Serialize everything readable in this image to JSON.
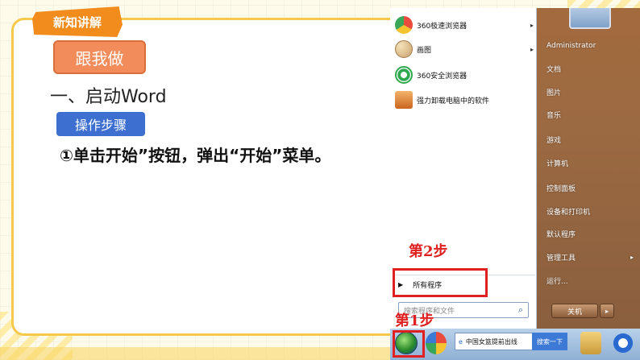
{
  "slide": {
    "section_tag": "新知讲解",
    "follow_button": "跟我做",
    "heading": "一、启动Word",
    "steps_label": "操作步骤",
    "instruction": "①单击开始”按钮，弹出“开始”菜单。"
  },
  "start_menu": {
    "programs": [
      {
        "label": "360极速浏览器",
        "icon": "chrome-like-icon",
        "has_arrow": true,
        "color": "#e94c3d"
      },
      {
        "label": "画图",
        "icon": "paint-palette-icon",
        "has_arrow": true,
        "color": "#5fa4e0"
      },
      {
        "label": "360安全浏览器",
        "icon": "ie-like-icon",
        "has_arrow": false,
        "color": "#2fa84f"
      },
      {
        "label": "强力卸载电脑中的软件",
        "icon": "uninstall-box-icon",
        "has_arrow": false,
        "color": "#e0813a"
      }
    ],
    "all_programs": "所有程序",
    "search_placeholder": "搜索程序和文件",
    "places": [
      {
        "label": "Administrator",
        "has_arrow": false
      },
      {
        "label": "文档",
        "has_arrow": false
      },
      {
        "label": "图片",
        "has_arrow": false
      },
      {
        "label": "音乐",
        "has_arrow": false
      },
      {
        "label": "游戏",
        "has_arrow": false
      },
      {
        "label": "计算机",
        "has_arrow": false
      },
      {
        "label": "控制面板",
        "has_arrow": false
      },
      {
        "label": "设备和打印机",
        "has_arrow": false
      },
      {
        "label": "默认程序",
        "has_arrow": false
      },
      {
        "label": "管理工具",
        "has_arrow": true
      },
      {
        "label": "运行...",
        "has_arrow": false
      }
    ],
    "shutdown": "关机",
    "shutdown_arrow": "▸"
  },
  "taskbar": {
    "address_text": "中国女篮提前出线",
    "search_button": "搜索一下"
  },
  "annotations": {
    "step2": "第2步",
    "step1": "第1步"
  },
  "colors": {
    "accent_orange": "#f28c1c",
    "steps_blue": "#3d6fd0",
    "highlight_red": "#e02020",
    "frame_yellow": "#f7c94a"
  }
}
